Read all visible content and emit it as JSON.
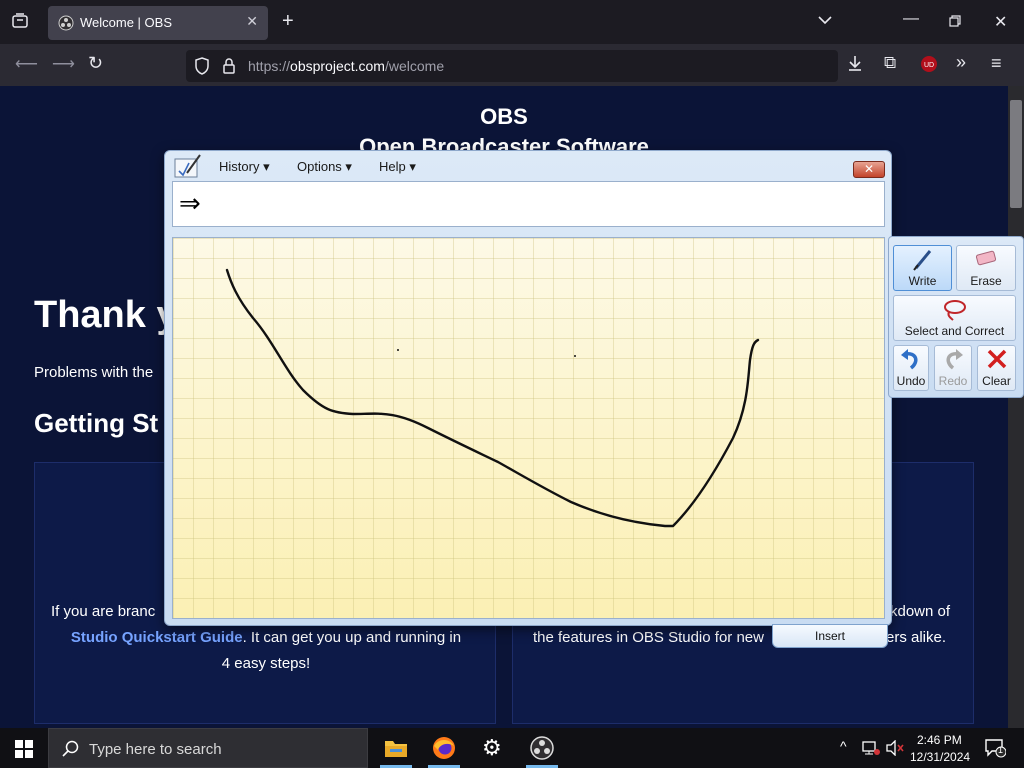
{
  "browser": {
    "tab_title": "Welcome | OBS",
    "url_prefix": "https://",
    "url_host": "obsproject.com",
    "url_path": "/welcome"
  },
  "page": {
    "heading": "OBS",
    "subheading": "Open Broadcaster Software",
    "thank_text": "Thank y",
    "problems_text": "Problems with the",
    "getting_started": "Getting St",
    "card_left_line1": "If you are branc",
    "card_left_link": "Studio Quickstart Guide",
    "card_left_line2_rest": ". It can get you up and running in",
    "card_left_line3": "4 easy steps!",
    "card_right_line1": "kdown of",
    "card_right_line2a": "the features in OBS Studio for new",
    "card_right_line2b": "ers alike."
  },
  "math_input_panel": {
    "menus": [
      "History",
      "Options",
      "Help"
    ],
    "preview_symbol": "⇒",
    "tools": {
      "write": "Write",
      "erase": "Erase",
      "select_correct": "Select and Correct",
      "undo": "Undo",
      "redo": "Redo",
      "clear": "Clear"
    },
    "insert_label": "Insert"
  },
  "taskbar": {
    "search_placeholder": "Type here to search",
    "time": "2:46 PM",
    "date": "12/31/2024",
    "notification_count": "1"
  },
  "colors": {
    "page_bg": "#0b1437",
    "link": "#76a3ff",
    "canvas_bg": "#fcf4c5",
    "ink": "#111111"
  },
  "icons": [
    "tab-list-icon",
    "obs-favicon-icon",
    "back-icon",
    "forward-icon",
    "reload-icon",
    "shield-icon",
    "lock-icon",
    "reader-icon",
    "star-icon",
    "download-icon",
    "extensions-icon",
    "ublock-icon",
    "overflow-icon",
    "menu-icon",
    "windows-start-icon",
    "search-icon",
    "file-explorer-icon",
    "firefox-icon",
    "settings-icon",
    "obs-icon"
  ]
}
